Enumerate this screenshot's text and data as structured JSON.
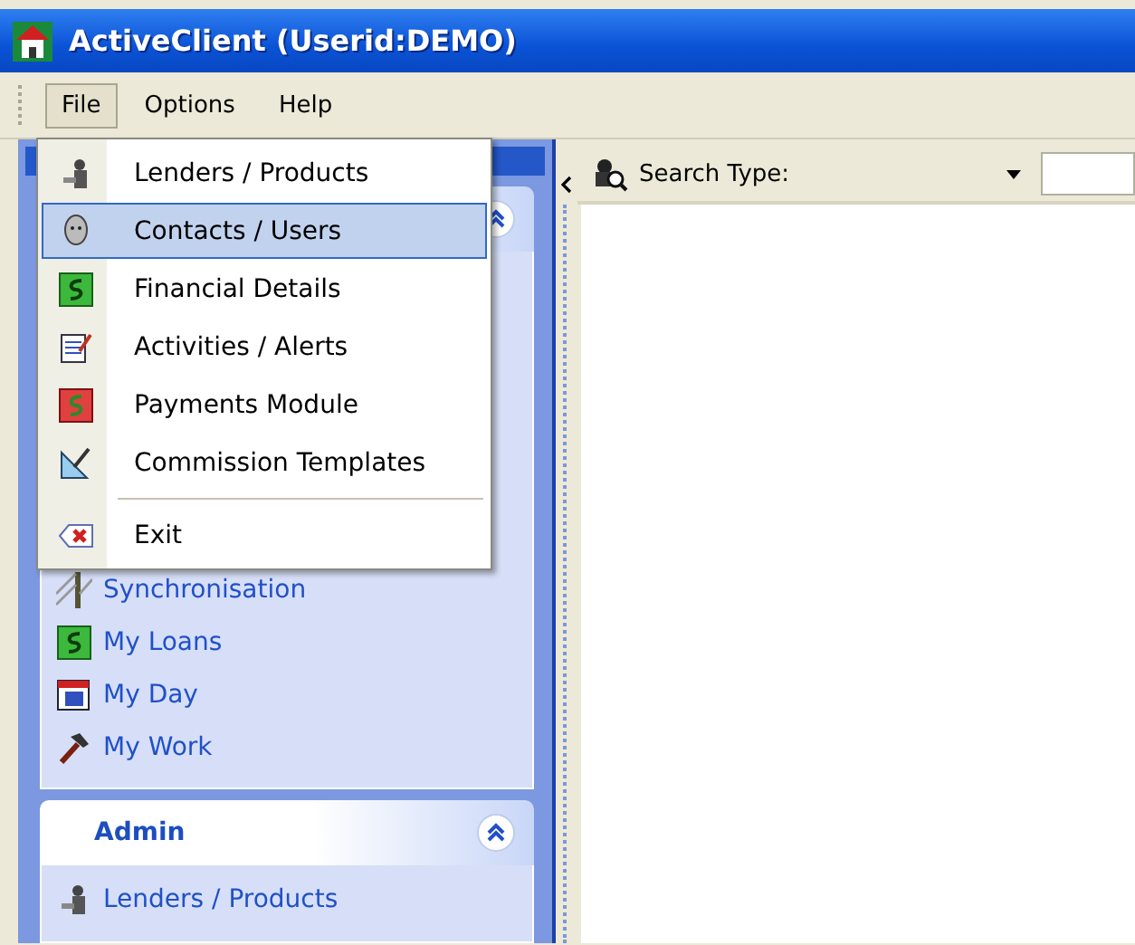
{
  "window": {
    "title": "ActiveClient (Userid:DEMO)"
  },
  "menu_bar": [
    {
      "label": "File",
      "selected": true
    },
    {
      "label": "Options",
      "selected": false
    },
    {
      "label": "Help",
      "selected": false
    }
  ],
  "file_menu": [
    {
      "kind": "item",
      "label": "Lenders / Products",
      "selected": false
    },
    {
      "kind": "item",
      "label": "Contacts / Users",
      "selected": true
    },
    {
      "kind": "item",
      "label": "Financial Details",
      "selected": false
    },
    {
      "kind": "item",
      "label": "Activities / Alerts",
      "selected": false
    },
    {
      "kind": "item",
      "label": "Payments Module",
      "selected": false
    },
    {
      "kind": "item",
      "label": "Commission Templates",
      "selected": false
    },
    {
      "kind": "separator"
    },
    {
      "kind": "item",
      "label": "Exit",
      "selected": false
    }
  ],
  "sidebar": {
    "panels": [
      {
        "items": [
          {
            "label": "Synchronisation"
          },
          {
            "label": "My Loans"
          },
          {
            "label": "My Day"
          },
          {
            "label": "My Work"
          }
        ]
      },
      {
        "title": "Admin",
        "items": [
          {
            "label": "Lenders / Products"
          }
        ]
      }
    ]
  },
  "search_bar": {
    "label": "Search Type:"
  }
}
